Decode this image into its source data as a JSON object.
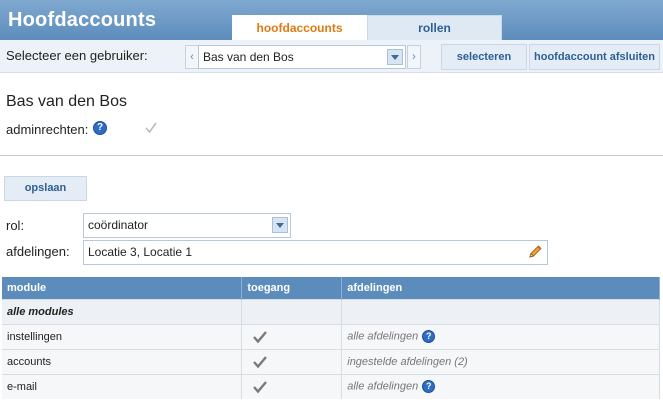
{
  "header": {
    "title": "Hoofdaccounts",
    "tabs": [
      {
        "label": "hoofdaccounts",
        "active": true
      },
      {
        "label": "rollen",
        "active": false
      }
    ]
  },
  "userbar": {
    "label": "Selecteer een gebruiker:",
    "prev_arrow": "‹",
    "next_arrow": "›",
    "selected_user": "Bas van den Bos",
    "select_button": "selecteren",
    "close_button": "hoofdaccount afsluiten"
  },
  "user": {
    "name": "Bas van den Bos",
    "admin_label": "adminrechten:",
    "help": "?"
  },
  "form": {
    "save_button": "opslaan",
    "rol_label": "rol:",
    "rol_value": "coördinator",
    "afdelingen_label": "afdelingen:",
    "afdelingen_value": "Locatie 3, Locatie 1"
  },
  "table": {
    "headers": [
      "module",
      "toegang",
      "afdelingen"
    ],
    "group_label": "alle modules",
    "rows": [
      {
        "module": "instellingen",
        "afdelingen": "alle afdelingen",
        "help": "?"
      },
      {
        "module": "accounts",
        "afdelingen": "ingestelde afdelingen (2)",
        "help": ""
      },
      {
        "module": "e-mail",
        "afdelingen": "alle afdelingen",
        "help": "?"
      }
    ]
  },
  "colors": {
    "header_bg": "#5d8dbd",
    "active_tab_text": "#e07a14",
    "button_text": "#2e5f92",
    "table_header_bg": "#5c8cbb"
  }
}
